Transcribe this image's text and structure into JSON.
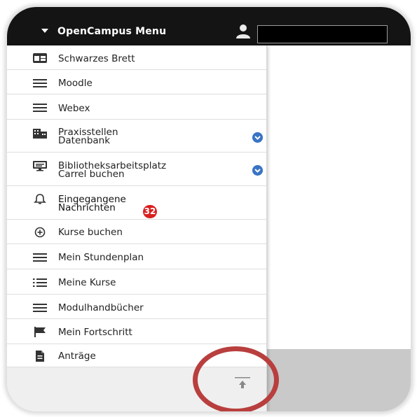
{
  "header": {
    "title": "OpenCampus Menu"
  },
  "menu": [
    {
      "label_1": "Schwarzes Brett",
      "icon": "board-icon"
    },
    {
      "label_1": "Moodle",
      "icon": "lines-icon"
    },
    {
      "label_1": "Webex",
      "icon": "lines-icon"
    },
    {
      "label_1": "Praxisstellen",
      "label_2": "Datenbank",
      "icon": "building-icon",
      "expand": "chevron-down-icon"
    },
    {
      "label_1": "Bibliotheksarbeitsplatz",
      "label_2": "Carrel buchen",
      "icon": "monitor-icon",
      "expand": "chevron-down-icon"
    },
    {
      "label_1": "Eingegangene",
      "label_2": "Nachrichten",
      "icon": "bell-icon",
      "badge": "32"
    },
    {
      "label_1": "Kurse buchen",
      "icon": "plus-circle-icon"
    },
    {
      "label_1": "Mein Stundenplan",
      "icon": "lines-icon"
    },
    {
      "label_1": "Meine Kurse",
      "icon": "list-icon"
    },
    {
      "label_1": "Modulhandbücher",
      "icon": "lines-icon"
    },
    {
      "label_1": "Mein Fortschritt",
      "icon": "flag-icon"
    },
    {
      "label_1": "Anträge",
      "icon": "document-icon"
    }
  ],
  "colors": {
    "header_bg": "#141414",
    "badge": "#d92020",
    "chevron": "#3a74c4",
    "highlight_circle": "#b83f3e"
  }
}
